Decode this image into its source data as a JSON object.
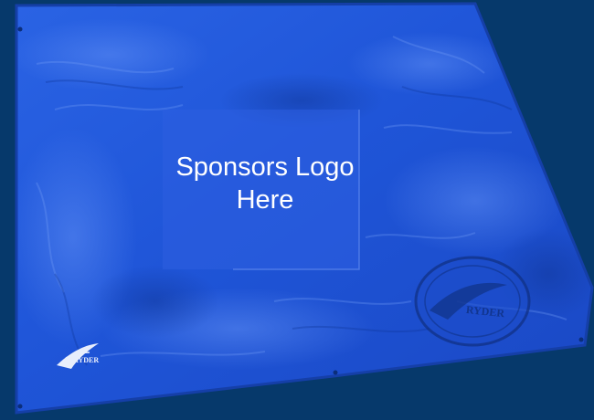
{
  "placeholder": {
    "line1": "Sponsors Logo",
    "line2": "Here"
  },
  "brand": {
    "small_logo_text": "RYDER",
    "stamp_text": "RYDER"
  },
  "colors": {
    "background": "#06396b",
    "tarp": "#1f55d8",
    "tarp_highlight": "#3f76ee",
    "placeholder_box": "#2e5ee0",
    "text": "#ffffff"
  }
}
